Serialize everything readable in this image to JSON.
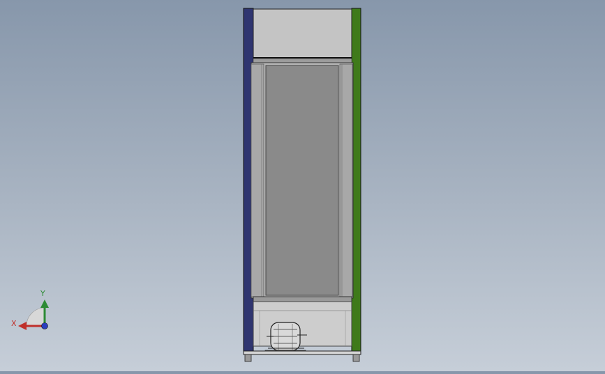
{
  "scene": {
    "model": "refrigerator-cabinet-front-view",
    "background_top": "#8797ab",
    "background_bottom": "#c6ced8",
    "colors": {
      "left_edge": "#2f3570",
      "right_edge": "#3f7a1a",
      "top_panel": "#c4c4c4",
      "door_glass": "#8a8a8a",
      "door_frame": "#b6b6b6",
      "compressor_bay": "#cdcdcd"
    }
  },
  "triad": {
    "x_label": "X",
    "y_label": "Y",
    "x_color": "#c0302a",
    "y_color": "#2d8b35",
    "z_color": "#2b3fbf"
  }
}
